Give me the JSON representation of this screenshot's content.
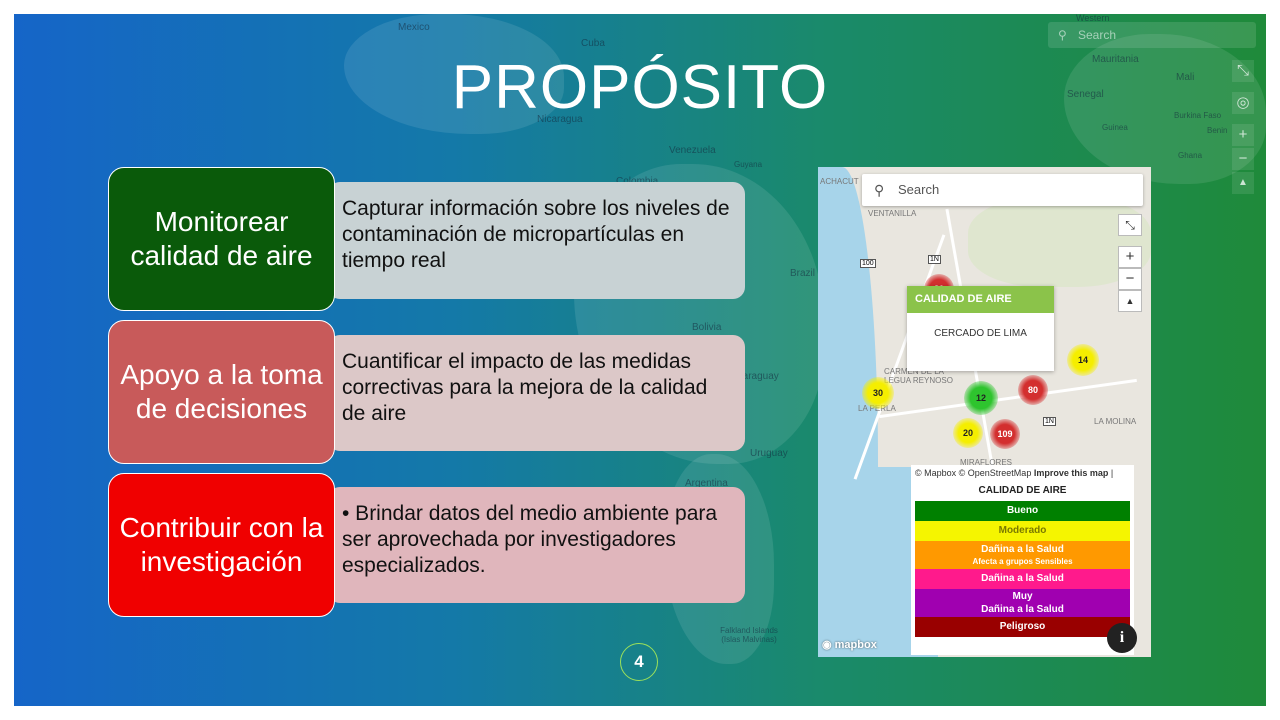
{
  "slide": {
    "title": "PROPÓSITO",
    "page_number": "4",
    "rows": [
      {
        "label": "Monitorear calidad de aire",
        "text": "Capturar información sobre los niveles de contaminación de micropartículas en tiempo real",
        "label_color": "#0a5a0a",
        "box_color": "#c8d2d4"
      },
      {
        "label": "Apoyo a la toma de decisiones",
        "text": "Cuantificar el impacto de las medidas correctivas para la mejora de la calidad de aire",
        "label_color": "#c85a5a",
        "box_color": "#dcc8c8"
      },
      {
        "label": "Contribuir con la investigación",
        "text": "• Brindar datos del medio ambiente para ser aprovechada por investigadores especializados.",
        "label_color": "#f00000",
        "box_color": "#e0b6bc"
      }
    ]
  },
  "background_map": {
    "search_placeholder": "Search",
    "labels": [
      "Mexico",
      "Cuba",
      "Nicaragua",
      "Venezuela",
      "Guyana",
      "Colombia",
      "Brazil",
      "Bolivia",
      "Paraguay",
      "Uruguay",
      "Argentina",
      "Falkland Islands (Islas Malvinas)",
      "Western",
      "Mauritania",
      "Mali",
      "Senegal",
      "Burkina Faso",
      "Guinea",
      "Benin",
      "Ghana"
    ]
  },
  "map_panel": {
    "search_placeholder": "Search",
    "popup": {
      "title": "CALIDAD DE AIRE",
      "location": "CERCADO DE LIMA"
    },
    "markers": [
      {
        "value": "80",
        "color": "#d32f2f"
      },
      {
        "value": "14",
        "color": "#f5ee00"
      },
      {
        "value": "30",
        "color": "#f5ee00"
      },
      {
        "value": "12",
        "color": "#2ec42e"
      },
      {
        "value": "80",
        "color": "#d32f2f"
      },
      {
        "value": "20",
        "color": "#f5ee00"
      },
      {
        "value": "109",
        "color": "#d32f2f"
      }
    ],
    "districts": [
      "ACHACUT",
      "VENTANILLA",
      "CARMEN DE LA LEGUA REYNOSO",
      "LA PERLA",
      "MIRAFLORES",
      "LA MOLINA"
    ],
    "road_shields": [
      "100",
      "1N",
      "1N"
    ],
    "attribution": "© Mapbox © OpenStreetMap",
    "improve_link": "Improve this map",
    "legend_title": "CALIDAD DE AIRE",
    "legend": [
      {
        "label": "Bueno",
        "sub": "",
        "color": "#008000",
        "text_color": "#ffffff"
      },
      {
        "label": "Moderado",
        "sub": "",
        "color": "#f5f500",
        "text_color": "#7a7a00"
      },
      {
        "label": "Dañina a la Salud",
        "sub": "Afecta a grupos Sensibles",
        "color": "#ff9900",
        "text_color": "#ffffff"
      },
      {
        "label": "Dañina a la Salud",
        "sub": "",
        "color": "#ff1a8c",
        "text_color": "#ffffff"
      },
      {
        "label": "Muy",
        "sub": "Dañina a la Salud",
        "color": "#a000b0",
        "text_color": "#ffffff"
      },
      {
        "label": "Peligroso",
        "sub": "",
        "color": "#990000",
        "text_color": "#ffffff"
      }
    ],
    "logo_text": "mapbox",
    "info_label": "i"
  }
}
